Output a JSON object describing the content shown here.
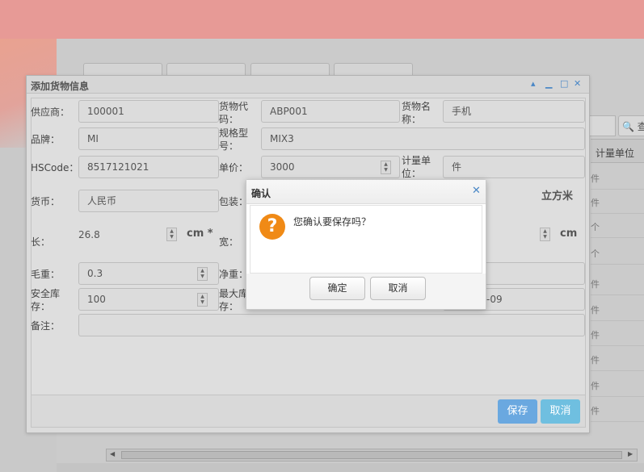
{
  "background": {
    "search_button": "🔍 查",
    "column_header": "计量单位",
    "column_cells": [
      "件",
      "件",
      "个",
      "个",
      "件",
      "件",
      "件",
      "件",
      "件",
      "件"
    ]
  },
  "dialog": {
    "title": "添加货物信息",
    "tools": {
      "collapse": "▴",
      "minimize": "▁",
      "maximize": "□",
      "close": "✕"
    },
    "fields": {
      "supplier": {
        "label": "供应商：",
        "value": "100001"
      },
      "goods_code": {
        "label": "货物代码：",
        "value": "ABP001"
      },
      "goods_name": {
        "label": "货物名称：",
        "value": "手机"
      },
      "brand": {
        "label": "品牌：",
        "value": "MI"
      },
      "model": {
        "label": "规格型号：",
        "value": "MIX3"
      },
      "hscode": {
        "label": "HSCode：",
        "value": "8517121021"
      },
      "unit_price": {
        "label": "单价：",
        "value": "3000"
      },
      "measure_unit": {
        "label": "计量单位：",
        "value": "件"
      },
      "currency": {
        "label": "货币：",
        "value": "人民币"
      },
      "packing": {
        "label": "包装："
      },
      "volume_unit": "立方米",
      "length": {
        "label": "长：",
        "value": "26.8",
        "unit": "cm *"
      },
      "width": {
        "label": "宽："
      },
      "height_unit": "cm",
      "gross_weight": {
        "label": "毛重：",
        "value": "0.3"
      },
      "net_weight": {
        "label": "净重："
      },
      "safety_stock": {
        "label": "安全库存：",
        "value": "100"
      },
      "max_stock": {
        "label": "最大库存："
      },
      "date_partial": "-09",
      "remark": {
        "label": "备注：",
        "value": ""
      }
    },
    "buttons": {
      "save": "保存",
      "cancel": "取消"
    }
  },
  "confirm": {
    "title": "确认",
    "close": "✕",
    "icon": "question-icon",
    "icon_glyph": "?",
    "message": "您确认要保存吗？",
    "ok": "确定",
    "cancel": "取消"
  }
}
